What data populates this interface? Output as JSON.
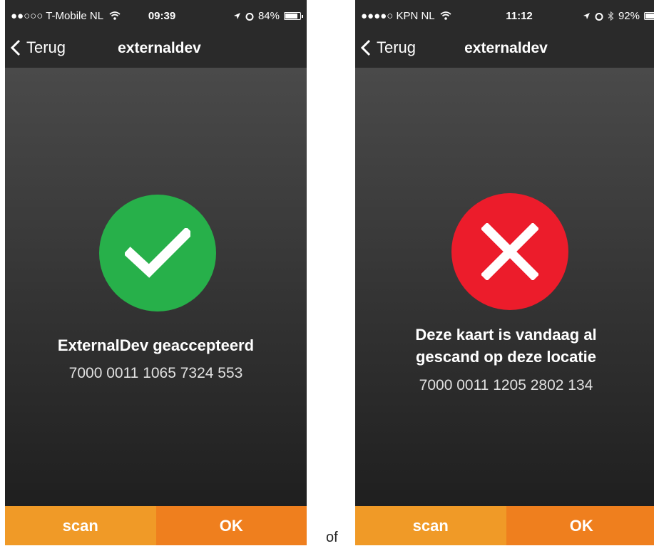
{
  "separator_text": "of",
  "screens": [
    {
      "status": {
        "carrier": "●●○○○ T-Mobile NL",
        "time": "09:39",
        "battery_percent": "84%",
        "battery_level": 0.84
      },
      "nav": {
        "back_label": "Terug",
        "title": "externaldev"
      },
      "result": {
        "state": "accepted",
        "icon": "checkmark-icon",
        "color": "#27b04a",
        "message_lines": [
          "ExternalDev geaccepteerd"
        ],
        "card_number": "7000 0011 1065 7324 553"
      },
      "buttons": {
        "scan_label": "scan",
        "ok_label": "OK"
      }
    },
    {
      "status": {
        "carrier": "●●●●○ KPN NL",
        "time": "11:12",
        "battery_percent": "92%",
        "battery_level": 0.92
      },
      "nav": {
        "back_label": "Terug",
        "title": "externaldev"
      },
      "result": {
        "state": "rejected",
        "icon": "cross-icon",
        "color": "#ec1c2b",
        "message_lines": [
          "Deze kaart is vandaag al",
          "gescand op deze locatie"
        ],
        "card_number": "7000 0011 1205 2802 134"
      },
      "buttons": {
        "scan_label": "scan",
        "ok_label": "OK"
      }
    }
  ],
  "colors": {
    "scan_button": "#f09a27",
    "ok_button": "#ef7f1e",
    "navbar": "#2a2a2a"
  }
}
